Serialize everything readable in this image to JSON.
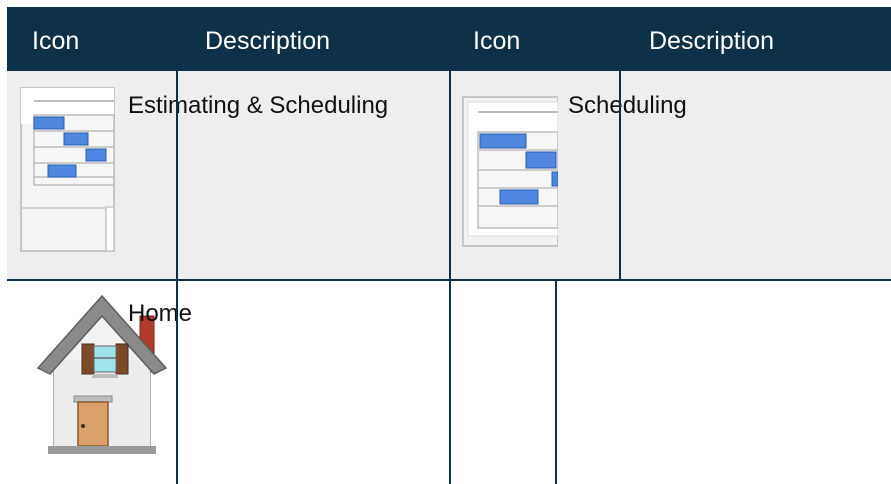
{
  "table": {
    "headers": [
      "Icon",
      "Description",
      "Icon",
      "Description"
    ],
    "rows": [
      {
        "left_icon": "estimating-scheduling-icon",
        "left_description": "Estimating & Scheduling",
        "right_icon": "scheduling-icon",
        "right_description": "Scheduling"
      },
      {
        "left_icon": "home-icon",
        "left_description": "Home",
        "right_icon": "",
        "right_description": ""
      }
    ]
  },
  "colors": {
    "header_background": "#0d3148",
    "header_text": "#ffffff",
    "row_shaded": "#eeeeee",
    "gantt_bar": "#4f86e0"
  }
}
